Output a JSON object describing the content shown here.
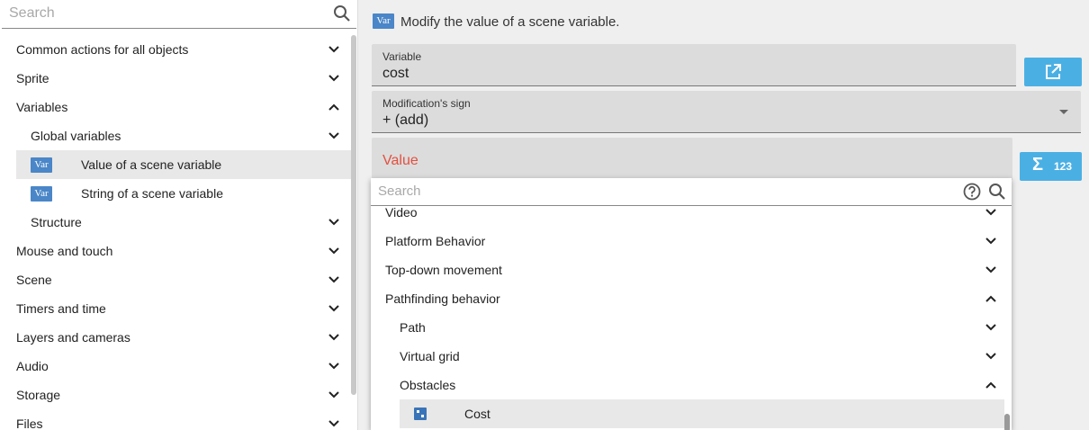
{
  "left_panel": {
    "search": {
      "placeholder": "Search"
    },
    "items": [
      {
        "label": "Common actions for all objects",
        "level": 0,
        "expanded": false
      },
      {
        "label": "Sprite",
        "level": 0,
        "expanded": false
      },
      {
        "label": "Variables",
        "level": 0,
        "expanded": true
      },
      {
        "label": "Global variables",
        "level": 1,
        "expanded": false
      },
      {
        "label": "Value of a scene variable",
        "level": 2,
        "selected": true,
        "icon": "variable-icon"
      },
      {
        "label": "String of a scene variable",
        "level": 2,
        "icon": "variable-icon"
      },
      {
        "label": "Structure",
        "level": 1,
        "expanded": false
      },
      {
        "label": "Mouse and touch",
        "level": 0,
        "expanded": false
      },
      {
        "label": "Scene",
        "level": 0,
        "expanded": false
      },
      {
        "label": "Timers and time",
        "level": 0,
        "expanded": false
      },
      {
        "label": "Layers and cameras",
        "level": 0,
        "expanded": false
      },
      {
        "label": "Audio",
        "level": 0,
        "expanded": false
      },
      {
        "label": "Storage",
        "level": 0,
        "expanded": false
      },
      {
        "label": "Files",
        "level": 0,
        "expanded": false
      }
    ]
  },
  "icons": {
    "variable_text": "Var"
  },
  "action": {
    "description": "Modify the value of a scene variable."
  },
  "fields": {
    "variable": {
      "label": "Variable",
      "value": "cost"
    },
    "sign": {
      "label": "Modification's sign",
      "value": "+ (add)"
    },
    "value": {
      "label": "Value"
    }
  },
  "buttons": {
    "expression_count": "123"
  },
  "dropdown": {
    "search_placeholder": "Search",
    "items": [
      {
        "label": "Video",
        "level": 0,
        "expanded": false
      },
      {
        "label": "Platform Behavior",
        "level": 0,
        "expanded": false
      },
      {
        "label": "Top-down movement",
        "level": 0,
        "expanded": false
      },
      {
        "label": "Pathfinding behavior",
        "level": 0,
        "expanded": true
      },
      {
        "label": "Path",
        "level": 1,
        "expanded": false
      },
      {
        "label": "Virtual grid",
        "level": 1,
        "expanded": false
      },
      {
        "label": "Obstacles",
        "level": 1,
        "expanded": true
      },
      {
        "label": "Cost",
        "level": 2,
        "selected": true
      }
    ]
  },
  "colors": {
    "accent": "#4ab0e4",
    "error": "#e25041",
    "variable_icon": "#4a86c8"
  }
}
